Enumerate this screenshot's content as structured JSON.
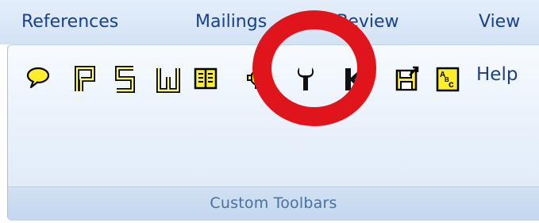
{
  "tabs": {
    "references": "References",
    "mailings": "Mailings",
    "review": "Review",
    "view": "View"
  },
  "toolbar": {
    "icons": [
      "comment-bubble-icon",
      "letter-p-icon",
      "letter-s-icon",
      "letter-w-icon",
      "book-icon",
      "gear-icon",
      "wrench-icon",
      "letter-k-icon",
      "save-export-icon",
      "abc-spellcheck-icon"
    ],
    "help_label": "Help"
  },
  "group": {
    "label": "Custom Toolbars"
  },
  "annotation": {
    "color": "#e0141b"
  },
  "colors": {
    "tab_text": "#15428b",
    "ribbon_bg": "#e9f1fb",
    "group_label": "#4b6f9d"
  }
}
